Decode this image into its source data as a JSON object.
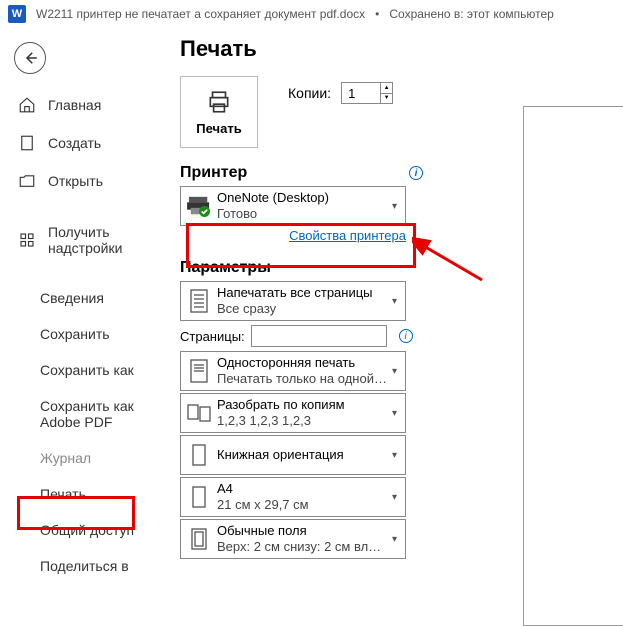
{
  "titlebar": {
    "filename": "W2211 принтер не печатает а сохраняет документ pdf.docx",
    "saved": "Сохранено в: этот компьютер"
  },
  "nav": {
    "home": "Главная",
    "create": "Создать",
    "open": "Открыть",
    "addins": "Получить надстройки",
    "info": "Сведения",
    "save": "Сохранить",
    "saveas": "Сохранить как",
    "save_adobe": "Сохранить как Adobe PDF",
    "history": "Журнал",
    "print": "Печать",
    "share": "Общий доступ",
    "share_with": "Поделиться в"
  },
  "content": {
    "title": "Печать",
    "print_btn": "Печать",
    "copies_lbl": "Копии:",
    "copies_val": "1",
    "printer_h": "Принтер",
    "printer": {
      "name": "OneNote (Desktop)",
      "status": "Готово"
    },
    "printer_props": "Свойства принтера",
    "params_h": "Параметры",
    "pages_lbl": "Страницы:",
    "opts": {
      "pages": {
        "l1": "Напечатать все страницы",
        "l2": "Все сразу"
      },
      "sides": {
        "l1": "Односторонняя печать",
        "l2": "Печатать только на одной с..."
      },
      "collate": {
        "l1": "Разобрать по копиям",
        "l2": "1,2,3    1,2,3    1,2,3"
      },
      "orient": {
        "l1": "Книжная ориентация",
        "l2": ""
      },
      "paper": {
        "l1": "A4",
        "l2": "21 см x 29,7 см"
      },
      "margins": {
        "l1": "Обычные поля",
        "l2": "Верх: 2 см снизу: 2 см влев..."
      }
    }
  }
}
